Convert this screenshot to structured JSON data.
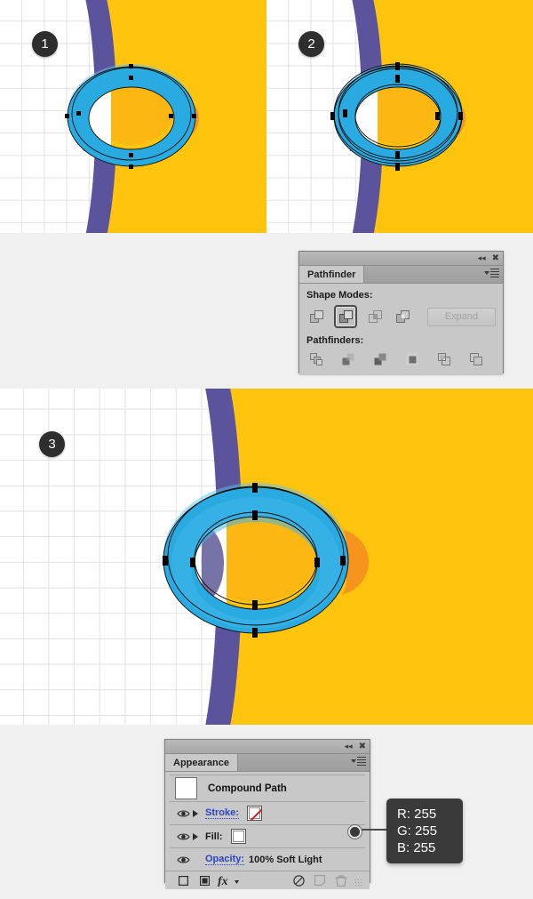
{
  "steps": [
    {
      "number": "1"
    },
    {
      "number": "2"
    },
    {
      "number": "3"
    }
  ],
  "pathfinder_panel": {
    "tab_label": "Pathfinder",
    "collapse_icon": "collapse-icon",
    "close_icon": "close-icon",
    "menu_icon": "panel-menu-icon",
    "shape_modes_label": "Shape Modes:",
    "pathfinders_label": "Pathfinders:",
    "expand_label": "Expand",
    "expand_enabled": false,
    "shape_modes": [
      {
        "name": "unite",
        "selected": false
      },
      {
        "name": "minus-front",
        "selected": true
      },
      {
        "name": "intersect",
        "selected": false
      },
      {
        "name": "exclude",
        "selected": false
      }
    ],
    "pathfinders": [
      {
        "name": "divide"
      },
      {
        "name": "trim"
      },
      {
        "name": "merge"
      },
      {
        "name": "crop"
      },
      {
        "name": "outline"
      },
      {
        "name": "minus-back"
      }
    ]
  },
  "appearance_panel": {
    "tab_label": "Appearance",
    "collapse_icon": "collapse-icon",
    "close_icon": "close-icon",
    "menu_icon": "panel-menu-icon",
    "target_label": "Compound Path",
    "rows": [
      {
        "name": "stroke",
        "label": "Stroke:",
        "is_link": true,
        "swatch": "none"
      },
      {
        "name": "fill",
        "label": "Fill:",
        "is_link": false,
        "swatch": "white"
      }
    ],
    "opacity": {
      "label": "Opacity:",
      "value": "100% Soft Light"
    },
    "footer_icons": [
      {
        "name": "add-new-stroke-icon"
      },
      {
        "name": "add-new-fill-icon"
      },
      {
        "name": "add-new-effect-icon"
      },
      {
        "name": "clear-appearance-icon"
      },
      {
        "name": "duplicate-item-icon"
      },
      {
        "name": "delete-item-icon"
      }
    ]
  },
  "color_tooltip": {
    "r": "R: 255",
    "g": "G: 255",
    "b": "B: 255"
  },
  "artwork_colors": {
    "ring_blue": "#29ABE2",
    "ring_blue_dark": "#1B9BD4",
    "ring_blue_light": "#5EC3EC",
    "yellow": "#FFC40D",
    "yellow_light": "#FCB713",
    "orange": "#F7941E",
    "purple": "#5B539B",
    "purple_dark": "#4B4488",
    "grid_line": "#E2E2E2",
    "background": "#F0F0F0",
    "badge": "#2E2E2E"
  }
}
